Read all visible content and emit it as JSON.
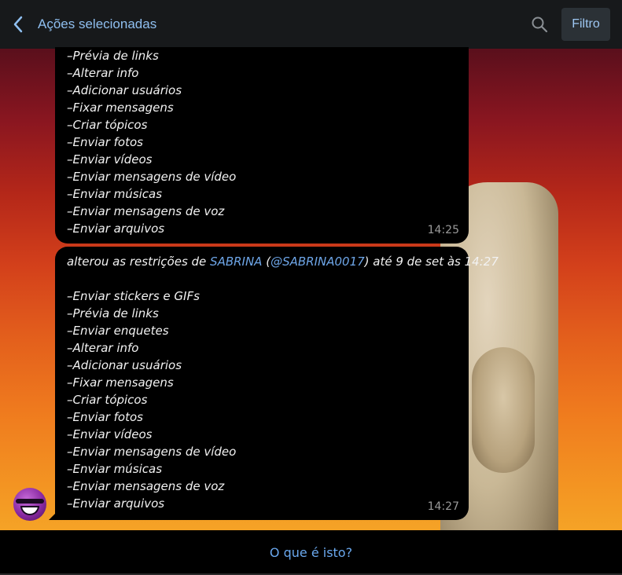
{
  "header": {
    "back_icon": "chevron-left-icon",
    "title": "Ações selecionadas",
    "search_icon": "search-icon",
    "filter_label": "Filtro"
  },
  "messages": [
    {
      "lines": [
        "–Prévia de links",
        "–Alterar info",
        "–Adicionar usuários",
        "–Fixar mensagens",
        "–Criar tópicos",
        "–Enviar fotos",
        "–Enviar vídeos",
        "–Enviar mensagens de vídeo",
        "–Enviar músicas",
        "–Enviar mensagens de voz",
        "–Enviar arquivos"
      ],
      "time": "14:25"
    },
    {
      "intro_prefix": "alterou as restrições de ",
      "user_name": "SABRINA",
      "user_handle_open": " (",
      "user_handle": "@SABRINA0017",
      "intro_suffix": ") até 9 de set às 14:27",
      "lines": [
        "–Enviar stickers e GIFs",
        "–Prévia de links",
        "–Enviar enquetes",
        "–Alterar info",
        "–Adicionar usuários",
        "–Fixar mensagens",
        "–Criar tópicos",
        "–Enviar fotos",
        "–Enviar vídeos",
        "–Enviar mensagens de vídeo",
        "–Enviar músicas",
        "–Enviar mensagens de voz",
        "–Enviar arquivos"
      ],
      "time": "14:27"
    }
  ],
  "footer": {
    "link_label": "O que é isto?"
  },
  "colors": {
    "accent": "#6ea6e8",
    "header_bg": "#17191b",
    "bubble_bg": "#000000"
  }
}
